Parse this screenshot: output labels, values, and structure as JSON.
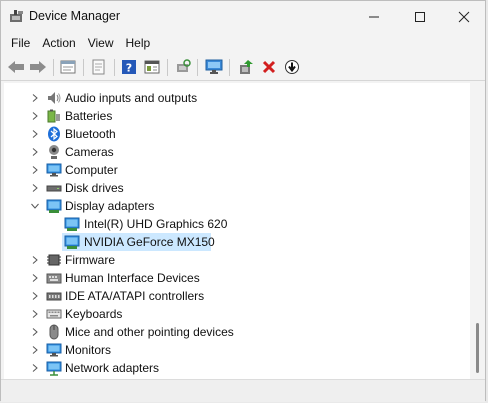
{
  "window": {
    "title": "Device Manager"
  },
  "menu": [
    "File",
    "Action",
    "View",
    "Help"
  ],
  "toolbar": {
    "buttons": [
      "back-arrow-icon",
      "forward-arrow-icon",
      "properties-icon",
      "printer-icon",
      "help-icon",
      "details-view-icon",
      "scan-hardware-icon",
      "monitor-icon",
      "update-driver-icon",
      "uninstall-icon",
      "disable-device-icon"
    ]
  },
  "tree": {
    "items": [
      {
        "label": "Audio inputs and outputs",
        "icon": "speaker-icon",
        "expanded": false
      },
      {
        "label": "Batteries",
        "icon": "battery-icon",
        "expanded": false
      },
      {
        "label": "Bluetooth",
        "icon": "bluetooth-icon",
        "expanded": false
      },
      {
        "label": "Cameras",
        "icon": "camera-icon",
        "expanded": false
      },
      {
        "label": "Computer",
        "icon": "computer-icon",
        "expanded": false
      },
      {
        "label": "Disk drives",
        "icon": "disk-drive-icon",
        "expanded": false
      },
      {
        "label": "Display adapters",
        "icon": "display-adapter-icon",
        "expanded": true
      },
      {
        "label": "Intel(R) UHD Graphics 620",
        "icon": "display-adapter-icon",
        "child": true
      },
      {
        "label": "NVIDIA GeForce MX150",
        "icon": "display-adapter-icon",
        "child": true,
        "selected": true
      },
      {
        "label": "Firmware",
        "icon": "firmware-icon",
        "expanded": false
      },
      {
        "label": "Human Interface Devices",
        "icon": "hid-icon",
        "expanded": false
      },
      {
        "label": "IDE ATA/ATAPI controllers",
        "icon": "ide-controller-icon",
        "expanded": false
      },
      {
        "label": "Keyboards",
        "icon": "keyboard-icon",
        "expanded": false
      },
      {
        "label": "Mice and other pointing devices",
        "icon": "mouse-icon",
        "expanded": false
      },
      {
        "label": "Monitors",
        "icon": "monitor-icon",
        "expanded": false
      },
      {
        "label": "Network adapters",
        "icon": "network-adapter-icon",
        "expanded": false
      }
    ]
  },
  "colors": {
    "selection": "#cce8ff",
    "accent": "#0078d4",
    "uninstall_red": "#d21f1f"
  }
}
